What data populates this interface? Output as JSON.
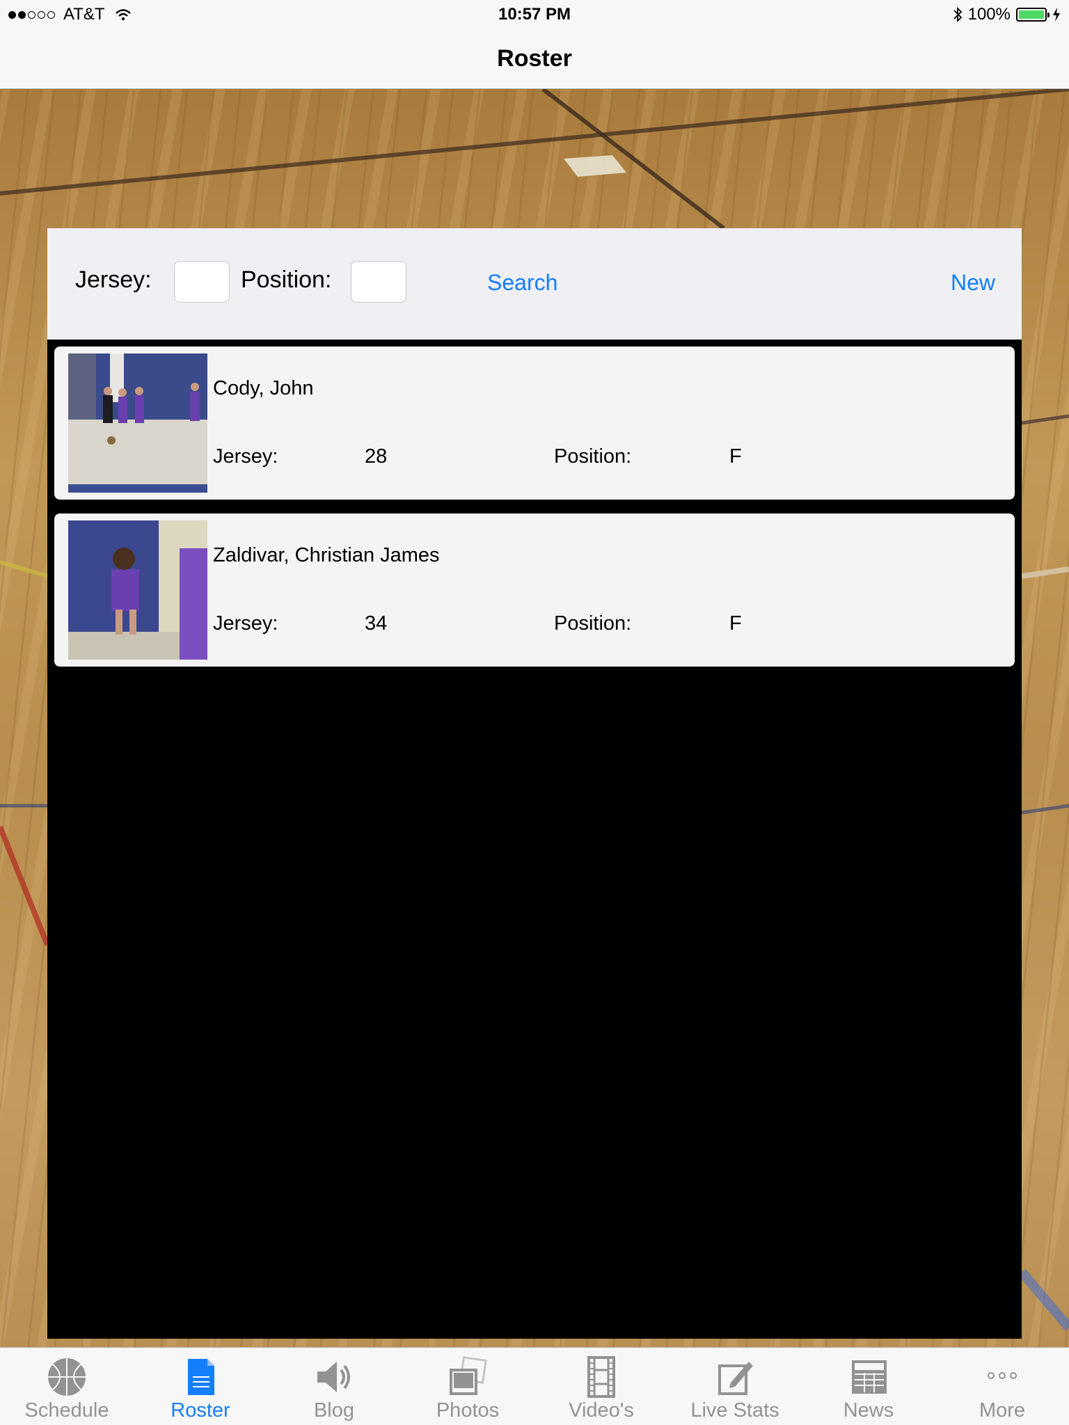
{
  "status_bar": {
    "carrier": "AT&T",
    "time": "10:57 PM",
    "battery": "100%",
    "battery_level": 1.0,
    "signal_bars_filled": 2,
    "signal_bars_total": 5
  },
  "nav": {
    "title": "Roster"
  },
  "search": {
    "jersey_label": "Jersey:",
    "jersey_value": "",
    "position_label": "Position:",
    "position_value": "",
    "search_button": "Search",
    "new_button": "New"
  },
  "roster": [
    {
      "name": "Cody, John",
      "jersey_label": "Jersey:",
      "jersey": "28",
      "position_label": "Position:",
      "position": "F"
    },
    {
      "name": "Zaldivar, Christian James",
      "jersey_label": "Jersey:",
      "jersey": "34",
      "position_label": "Position:",
      "position": "F"
    }
  ],
  "tabs": [
    {
      "label": "Schedule",
      "icon": "basketball-icon"
    },
    {
      "label": "Roster",
      "icon": "document-icon",
      "active": true
    },
    {
      "label": "Blog",
      "icon": "speaker-icon"
    },
    {
      "label": "Photos",
      "icon": "photos-icon"
    },
    {
      "label": "Video's",
      "icon": "film-icon"
    },
    {
      "label": "Live Stats",
      "icon": "edit-icon"
    },
    {
      "label": "News",
      "icon": "newspaper-icon"
    },
    {
      "label": "More",
      "icon": "more-icon"
    }
  ],
  "colors": {
    "accent": "#147efb",
    "inactive_tab": "#929292",
    "battery": "#4cd964"
  }
}
